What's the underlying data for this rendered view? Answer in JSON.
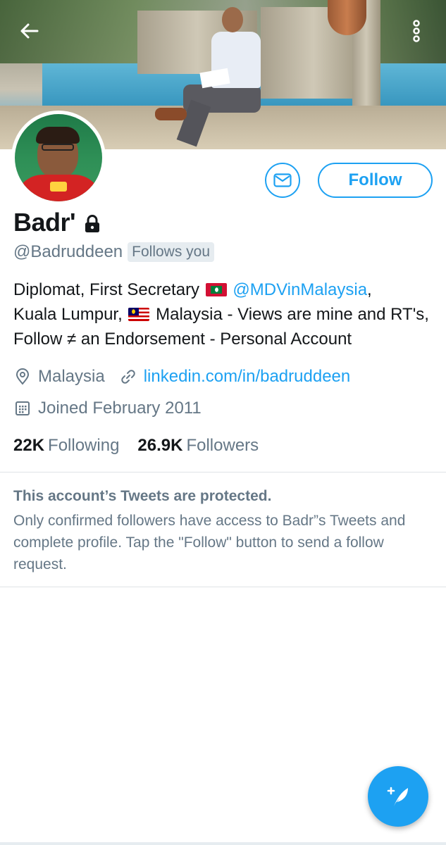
{
  "header": {
    "back_icon": "arrow-left-icon",
    "more_icon": "more-vertical-icon"
  },
  "profile": {
    "display_name": "Badr'",
    "lock_icon": "lock-icon",
    "handle": "@Badruddeen",
    "follows_you": "Follows you",
    "bio": {
      "line1_pre": "Diplomat, First Secretary",
      "flag1": "maldives-flag",
      "mention": "@MDVinMalaysia",
      "line1_post": ",",
      "line2_pre": "Kuala Lumpur,",
      "flag2": "malaysia-flag",
      "line2_post": "Malaysia - Views are mine and RT's, Follow ≠ an Endorsement - Personal Account"
    },
    "location": "Malaysia",
    "website": "linkedin.com/in/badruddeen",
    "joined": "Joined February 2011",
    "following_count": "22K",
    "following_label": "Following",
    "followers_count": "26.9K",
    "followers_label": "Followers"
  },
  "actions": {
    "message_icon": "mail-icon",
    "follow_label": "Follow",
    "compose_icon": "compose-tweet-icon"
  },
  "protected": {
    "title": "This account’s Tweets are protected.",
    "body": "Only confirmed followers have access to Badr”s Tweets and complete profile. Tap the \"Follow\" button to send a follow request."
  },
  "colors": {
    "accent": "#1da1f2",
    "secondary_text": "#657786",
    "primary_text": "#14171a"
  }
}
